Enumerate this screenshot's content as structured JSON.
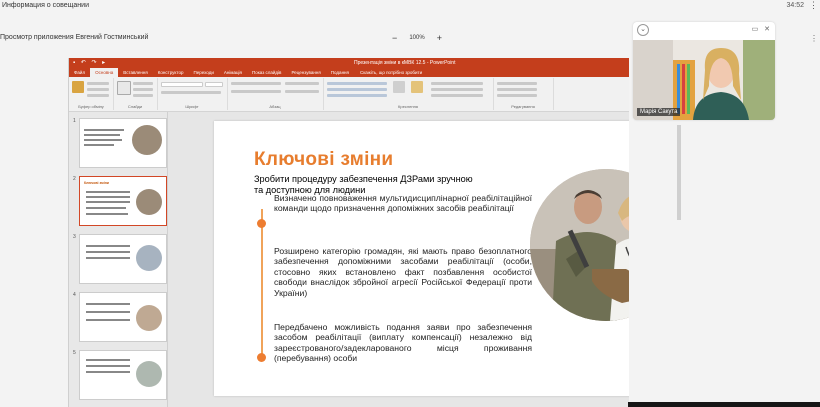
{
  "window": {
    "title": "Информация о совещании",
    "time": "34:52",
    "corner_icon": "⋮"
  },
  "viewer": {
    "title": "Просмотр приложения Евгений Гостминський",
    "zoom_minus": "−",
    "zoom_value": "100%",
    "zoom_plus": "+",
    "right_icon": "⋮"
  },
  "powerpoint": {
    "quick_access": "",
    "doc_title": "Презентація зміни в кМВК 12.5 - PowerPoint",
    "tabs": [
      "Файл",
      "Основна",
      "Вставлення",
      "Конструктор",
      "Переходи",
      "Анімація",
      "Показ слайдів",
      "Рецензування",
      "Подання"
    ],
    "tell_me": "Скажіть, що потрібно зробити",
    "ribbon_groups": [
      "Буфер обміну",
      "Слайди",
      "Шрифт",
      "Абзац",
      "Креслення",
      "Редагування"
    ]
  },
  "thumbnails": [
    {
      "num": "1",
      "title": "Запропоновані зміни"
    },
    {
      "num": "2",
      "title": "Ключові зміни"
    },
    {
      "num": "3",
      "title": ""
    },
    {
      "num": "4",
      "title": ""
    },
    {
      "num": "5",
      "title": ""
    }
  ],
  "slide": {
    "title": "Ключові зміни",
    "subtitle": "Зробити процедуру забезпечення ДЗРами зручною та доступною для людини",
    "paragraphs": [
      "Визначено повноваження мультидисциплінарної реабілітаційної команди щодо призначення допоміжних засобів реабілітації",
      "Розширено категорію громадян, які мають право безоплатного забезпечення допоміжними засобами реабілітації (особи, стосовно яких встановлено факт позбавлення особистої свободи внаслідок збройної агресії Російської Федерації проти України)",
      "Передбачено можливість подання заяви про забезпечення засобом реабілітації (виплату компенсації) незалежно від зареєстрованого/задекларованого місця проживання (перебування) особи"
    ],
    "page_num": "2"
  },
  "camera": {
    "name": "Марія Сакута"
  },
  "colors": {
    "ppt_red": "#c43e1c",
    "accent_orange": "#e77d2e"
  }
}
